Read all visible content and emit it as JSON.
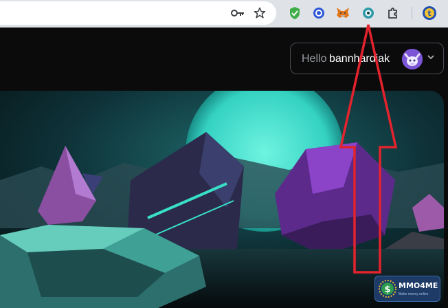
{
  "browser": {
    "toolbar_icons": [
      "key-icon",
      "star-icon",
      "shield-check-icon",
      "circle-o-extension-icon",
      "metamask-fox-icon",
      "eye-extension-icon",
      "puzzle-extensions-icon",
      "profile-t-icon"
    ]
  },
  "header": {
    "greeting": "Hello",
    "username": "bannhardiak"
  },
  "watermark": {
    "title": "MMO4ME",
    "subtitle": "Make money online"
  },
  "colors": {
    "annotation_red": "#e3232d",
    "teal": "#2fd3c3",
    "purple": "#7a2fb0"
  }
}
